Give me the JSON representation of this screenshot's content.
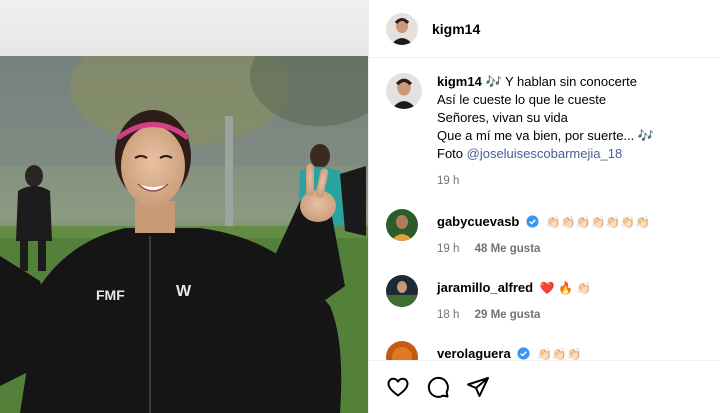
{
  "post": {
    "photo": {
      "jacket_logo": "FMF",
      "brand_logo": "W"
    }
  },
  "header": {
    "username": "kigm14"
  },
  "caption": {
    "username": "kigm14",
    "lines": [
      "🎶 Y hablan sin conocerte",
      "Así le cueste lo que le cueste",
      "Señores, vivan su vida",
      "Que a mí me va bien, por suerte... 🎶"
    ],
    "photo_prefix": "Foto ",
    "photo_mention": "@joseluisescobarmejia_18",
    "time": "19 h"
  },
  "comments": [
    {
      "username": "gabycuevasb",
      "verified": true,
      "text": "👏🏻👏🏻👏🏻👏🏻👏🏻👏🏻👏🏻",
      "time": "19 h",
      "likes": "48 Me gusta",
      "avatar_color": "#2b5c2a"
    },
    {
      "username": "jaramillo_alfred",
      "verified": false,
      "text": "❤️ 🔥 👏🏻",
      "time": "18 h",
      "likes": "29 Me gusta",
      "avatar_color": "#1d2a36"
    },
    {
      "username": "verolaguera",
      "verified": true,
      "text": "👏🏻👏🏻👏🏻",
      "time": "",
      "likes": "",
      "avatar_color": "#c45a12"
    }
  ],
  "actions": {
    "like": "heart-icon",
    "comment": "comment-icon",
    "share": "share-icon"
  }
}
